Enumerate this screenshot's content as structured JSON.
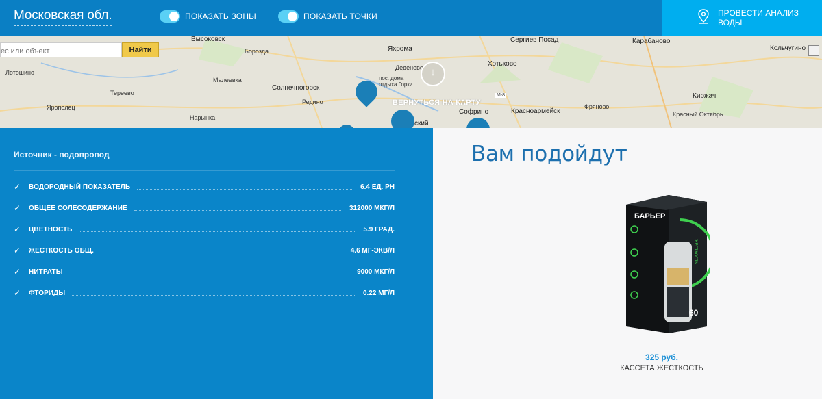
{
  "topbar": {
    "region": "Московская обл.",
    "toggle_zones": "ПОКАЗАТЬ ЗОНЫ",
    "toggle_points": "ПОКАЗАТЬ ТОЧКИ",
    "analyze_button": "ПРОВЕСТИ АНАЛИЗ ВОДЫ",
    "colors": {
      "bar": "#0a7fc4",
      "accent": "#00aeef",
      "toggle": "#5ad0f5"
    }
  },
  "map": {
    "search_placeholder": "ес или объект",
    "search_button": "Найти",
    "back_label": "ВЕРНУТЬСЯ НА КАРТУ",
    "labels": [
      "Высоковск",
      "Сергиев Посад",
      "Карабаново",
      "Кольчугино",
      "Борозда",
      "Яхрома",
      "Лотошино",
      "Малеевка",
      "Деденево",
      "пос. дома отдыха Горки",
      "Хотьково",
      "Тереево",
      "Солнечногорск",
      "Киржач",
      "Ярополец",
      "Редино",
      "Красноармейск",
      "Фряново",
      "Софрино",
      "Красный Октябрь",
      "Нарынка",
      "М-8",
      "ский"
    ]
  },
  "water": {
    "source_label": "Источник - водопровод",
    "params": [
      {
        "name": "ВОДОРОДНЫЙ ПОКАЗАТЕЛЬ",
        "value": "6.4 ЕД. PH"
      },
      {
        "name": "ОБЩЕЕ СОЛЕСОДЕРЖАНИЕ",
        "value": "312000 МКГ/Л"
      },
      {
        "name": "ЦВЕТНОСТЬ",
        "value": "5.9 ГРАД."
      },
      {
        "name": "ЖЕСТКОСТЬ ОБЩ.",
        "value": "4.6 МГ-ЭКВ/Л"
      },
      {
        "name": "НИТРАТЫ",
        "value": "9000 МКГ/Л"
      },
      {
        "name": "ФТОРИДЫ",
        "value": "0.22 МГ/Л"
      }
    ]
  },
  "recommend": {
    "title": "Вам подойдут",
    "product": {
      "price": "325 руб.",
      "name": "КАССЕТА ЖЕСТКОСТЬ",
      "box_brand": "БАРЬЕР",
      "box_label": "ЖЕСТКОСТЬ",
      "box_count": "60"
    }
  }
}
